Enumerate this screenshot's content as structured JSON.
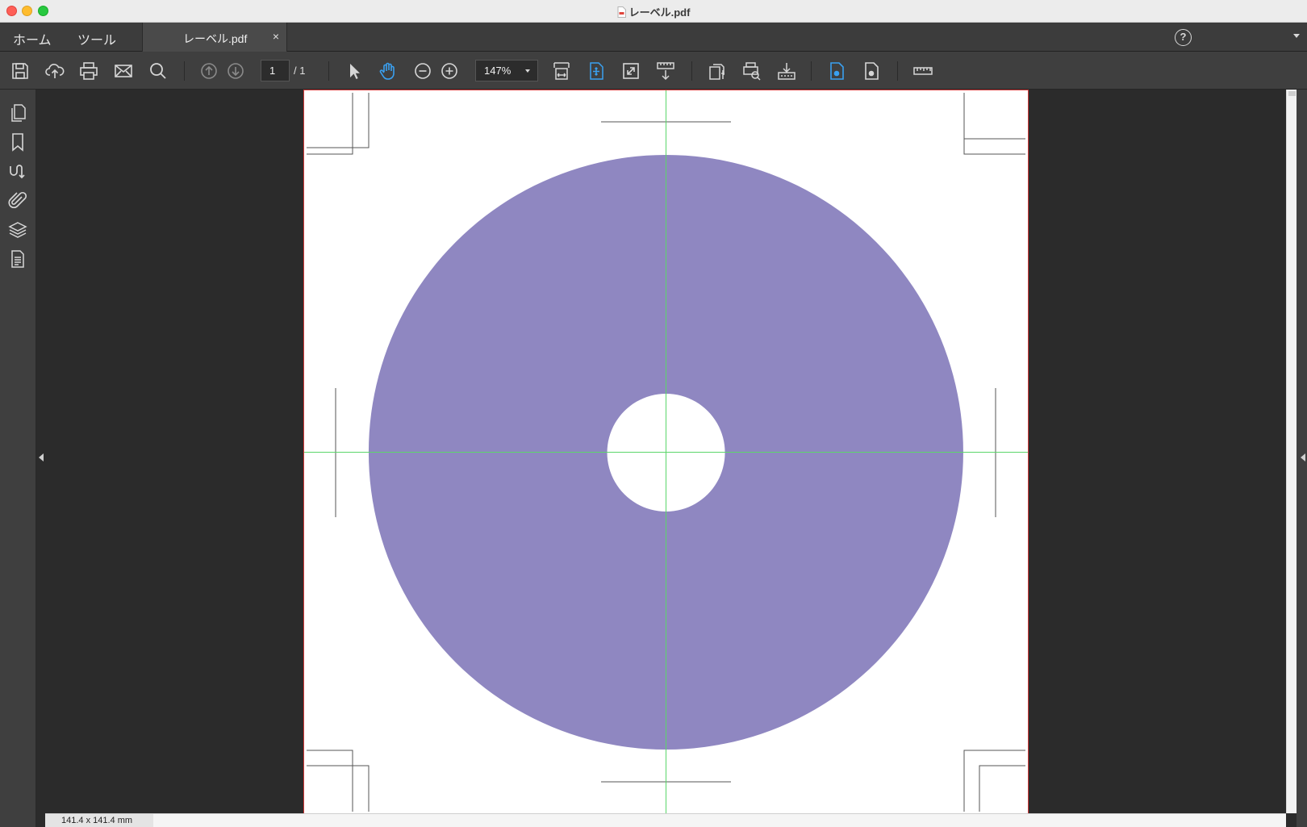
{
  "window": {
    "title": "レーベル.pdf"
  },
  "menu": {
    "home": "ホーム",
    "tools": "ツール"
  },
  "tab": {
    "label": "レーベル.pdf",
    "close": "×"
  },
  "help": {
    "label": "?"
  },
  "toolbar": {
    "page_current": "1",
    "page_total": "/ 1",
    "zoom": "147%",
    "icons": [
      "save-icon",
      "cloud-upload-icon",
      "print-icon",
      "mail-icon",
      "search-icon",
      "previous-page-icon",
      "next-page-icon",
      "select-arrow-icon",
      "hand-icon",
      "zoom-out-icon",
      "zoom-in-icon",
      "fit-width-icon",
      "fit-page-icon",
      "expand-icon",
      "scroll-mode-icon",
      "document-properties-icon",
      "print-preview-icon",
      "export-icon",
      "single-page-icon",
      "two-page-icon",
      "ruler-icon"
    ]
  },
  "sidebar": {
    "icons": [
      "pages-icon",
      "bookmark-icon",
      "signature-icon",
      "attachment-icon",
      "layers-icon",
      "document-icon"
    ]
  },
  "document": {
    "label_color": "#8f87c1",
    "guide_color": "#5bd66a",
    "border_color": "#d23a3a"
  },
  "status": {
    "dimensions": "141.4 x 141.4 mm"
  }
}
